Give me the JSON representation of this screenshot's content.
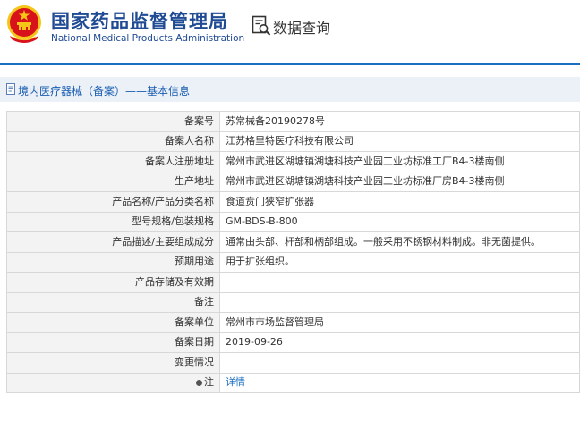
{
  "header": {
    "org_name_cn": "国家药品监督管理局",
    "org_name_en": "National Medical Products Administration",
    "query_label": "数据查询"
  },
  "section": {
    "title": "境内医疗器械（备案）——基本信息"
  },
  "record": {
    "rows": [
      {
        "label": "备案号",
        "value": "苏常械备20190278号"
      },
      {
        "label": "备案人名称",
        "value": "江苏格里特医疗科技有限公司"
      },
      {
        "label": "备案人注册地址",
        "value": "常州市武进区湖塘镇湖塘科技产业园工业坊标准工厂B4-3楼南侧"
      },
      {
        "label": "生产地址",
        "value": "常州市武进区湖塘镇湖塘科技产业园工业坊标准厂房B4-3楼南侧"
      },
      {
        "label": "产品名称/产品分类名称",
        "value": "食道贲门狭窄扩张器"
      },
      {
        "label": "型号规格/包装规格",
        "value": "GM-BDS-B-800"
      },
      {
        "label": "产品描述/主要组成成分",
        "value": "通常由头部、杆部和柄部组成。一般采用不锈钢材料制成。非无菌提供。"
      },
      {
        "label": "预期用途",
        "value": "用于扩张组织。"
      },
      {
        "label": "产品存储及有效期",
        "value": ""
      },
      {
        "label": "备注",
        "value": ""
      },
      {
        "label": "备案单位",
        "value": "常州市市场监督管理局"
      },
      {
        "label": "备案日期",
        "value": "2019-09-26"
      },
      {
        "label": "变更情况",
        "value": ""
      },
      {
        "label": "注",
        "value": "详情"
      }
    ]
  },
  "colors": {
    "brand_blue": "#1f4a94",
    "accent_blue": "#1a6fc0",
    "title_bar_bg": "#ecf1f8",
    "label_bg": "#f3f3f3",
    "emblem_red": "#d8121b",
    "emblem_gold": "#f5c518"
  }
}
